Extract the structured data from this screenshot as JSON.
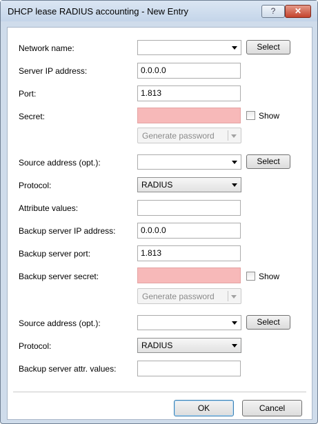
{
  "window": {
    "title": "DHCP lease RADIUS accounting - New Entry",
    "help_glyph": "?",
    "close_glyph": "✕"
  },
  "fields": {
    "network_name": {
      "label": "Network name:",
      "value": ""
    },
    "server_ip": {
      "label": "Server IP address:",
      "value": "0.0.0.0"
    },
    "port": {
      "label": "Port:",
      "value": "1.813"
    },
    "secret": {
      "label": "Secret:",
      "value": ""
    },
    "source_address": {
      "label": "Source address (opt.):",
      "value": ""
    },
    "protocol": {
      "label": "Protocol:",
      "value": "RADIUS"
    },
    "attribute_values": {
      "label": "Attribute values:",
      "value": ""
    },
    "backup_server_ip": {
      "label": "Backup server IP address:",
      "value": "0.0.0.0"
    },
    "backup_server_port": {
      "label": "Backup server port:",
      "value": "1.813"
    },
    "backup_server_secret": {
      "label": "Backup server secret:",
      "value": ""
    },
    "backup_source_address": {
      "label": "Source address (opt.):",
      "value": ""
    },
    "backup_protocol": {
      "label": "Protocol:",
      "value": "RADIUS"
    },
    "backup_attr_values": {
      "label": "Backup server attr. values:",
      "value": ""
    }
  },
  "buttons": {
    "select": "Select",
    "show": "Show",
    "generate_password": "Generate password",
    "ok": "OK",
    "cancel": "Cancel"
  },
  "colors": {
    "secret_bg": "#f7b9b9",
    "titlebar": "#c4d5e9"
  }
}
